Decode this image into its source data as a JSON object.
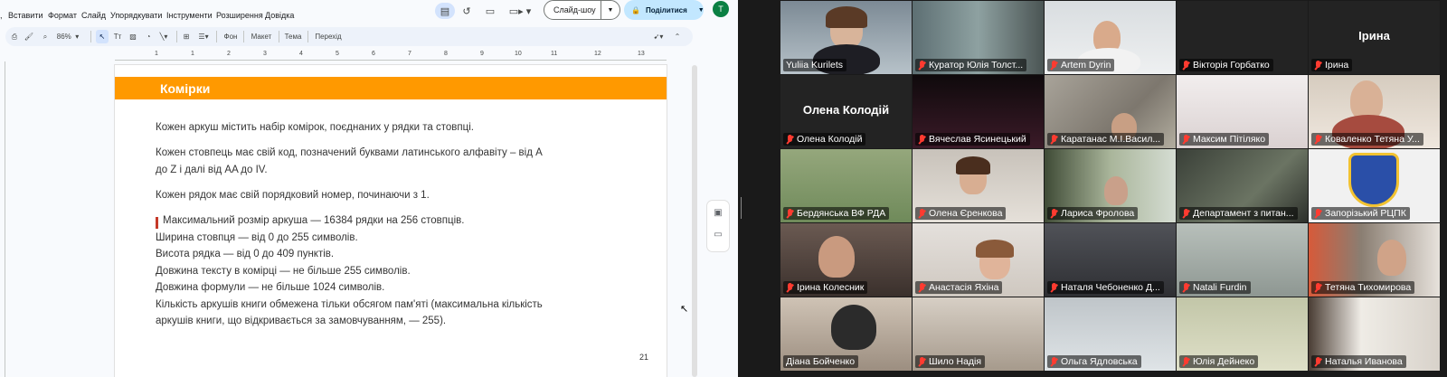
{
  "editor": {
    "menu": [
      "Вставити",
      "Формат",
      "Слайд",
      "Упорядкувати",
      "Інструменти",
      "Розширення",
      "Довідка"
    ],
    "slideshow_label": "Слайд-шоу",
    "share_label": "Поділитися",
    "avatar_letter": "T",
    "toolbar": {
      "zoom": "86%",
      "background": "Фон",
      "layout": "Макет",
      "theme": "Тема",
      "transition": "Перехід"
    },
    "ruler_numbers": [
      "1",
      "1",
      "2",
      "3",
      "4",
      "5",
      "6",
      "7",
      "8",
      "9",
      "10",
      "11",
      "12",
      "13"
    ]
  },
  "slide": {
    "title": "Комірки",
    "p1": "Кожен аркуш містить набір комірок, поєднаних у рядки та стовпці.",
    "p2_line1": "Кожен стовпець має свій код, позначений буквами латинського алфавіту – від A",
    "p2_line2": "до Z і далі від AA до IV.",
    "p3": "Кожен рядок має свій порядковий номер, починаючи з 1.",
    "list": [
      "Максимальний розмір аркуша — 16384 рядки на 256 стовпців.",
      "Ширина стовпця — від 0 до 255 символів.",
      "Висота рядка — від 0 до 409 пунктів.",
      "Довжина тексту в комірці — не більше 255 символів.",
      "Довжина формули — не більше 1024 символів.",
      "Кількість аркушів книги обмежена тільки обсягом пам'яті (максимальна кількість",
      "аркушів книги, що відкривається за замовчуванням, — 255)."
    ],
    "page_number": "21"
  },
  "participants": [
    {
      "name": "Yuliia Kurilets",
      "muted": false,
      "active": true,
      "center": ""
    },
    {
      "name": "Куратор Юлія Толст...",
      "muted": true,
      "active": false,
      "center": ""
    },
    {
      "name": "Artem Dyrin",
      "muted": true,
      "active": false,
      "center": ""
    },
    {
      "name": "Вікторія Горбатко",
      "muted": true,
      "active": false,
      "center": ""
    },
    {
      "name": "Ірина",
      "muted": true,
      "active": false,
      "center": "Ірина"
    },
    {
      "name": "Олена Колодій",
      "muted": true,
      "active": false,
      "center": "Олена Колодій"
    },
    {
      "name": "Вячеслав Ясинецький",
      "muted": true,
      "active": false,
      "center": ""
    },
    {
      "name": "Каратанас М.І.Васил...",
      "muted": true,
      "active": false,
      "center": ""
    },
    {
      "name": "Максим Пітіляко",
      "muted": true,
      "active": false,
      "center": ""
    },
    {
      "name": "Коваленко Тетяна У...",
      "muted": true,
      "active": false,
      "center": ""
    },
    {
      "name": "Бердянська ВФ РДА",
      "muted": true,
      "active": false,
      "center": ""
    },
    {
      "name": "Олена Єренкова",
      "muted": true,
      "active": false,
      "center": ""
    },
    {
      "name": "Лариса Фролова",
      "muted": true,
      "active": false,
      "center": ""
    },
    {
      "name": "Департамент з питан...",
      "muted": true,
      "active": false,
      "center": ""
    },
    {
      "name": "Запорізький РЦПК",
      "muted": true,
      "active": false,
      "center": ""
    },
    {
      "name": "Ірина Колесник",
      "muted": true,
      "active": false,
      "center": ""
    },
    {
      "name": "Анастасія Яхіна",
      "muted": true,
      "active": false,
      "center": ""
    },
    {
      "name": "Наталя Чебоненко Д...",
      "muted": true,
      "active": false,
      "center": ""
    },
    {
      "name": "Natali Furdin",
      "muted": true,
      "active": false,
      "center": ""
    },
    {
      "name": "Тетяна Тихомирова",
      "muted": true,
      "active": false,
      "center": ""
    },
    {
      "name": "Діана Бойченко",
      "muted": false,
      "active": false,
      "center": ""
    },
    {
      "name": "Шило Надія",
      "muted": true,
      "active": false,
      "center": ""
    },
    {
      "name": "Ольга Ядловська",
      "muted": true,
      "active": false,
      "center": ""
    },
    {
      "name": "Юлія Дейнеко",
      "muted": true,
      "active": false,
      "center": ""
    },
    {
      "name": "Наталья Иванова",
      "muted": true,
      "active": false,
      "center": ""
    }
  ]
}
